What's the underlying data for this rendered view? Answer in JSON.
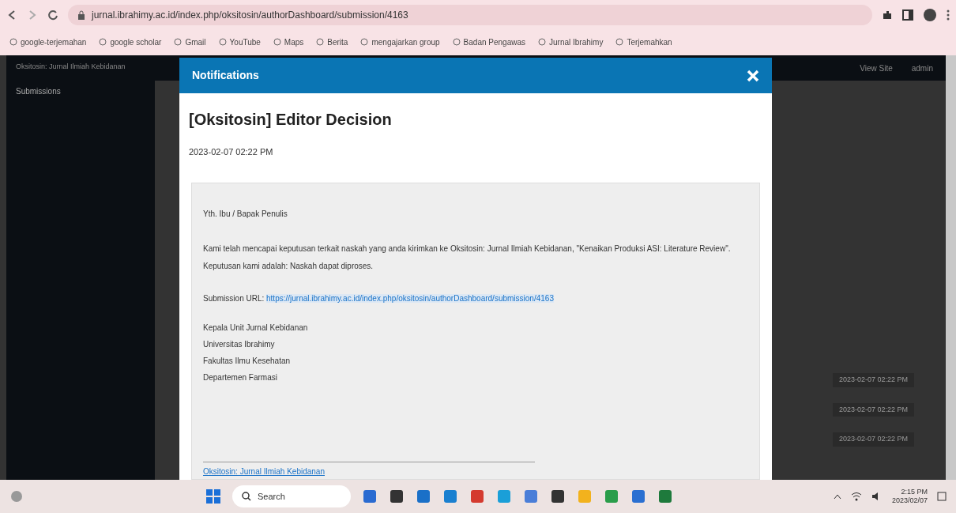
{
  "browser": {
    "url": "jurnal.ibrahimy.ac.id/index.php/oksitosin/authorDashboard/submission/4163",
    "bookmarks": [
      "google-terjemahan",
      "google scholar",
      "Gmail",
      "YouTube",
      "Maps",
      "Berita",
      "mengajarkan group",
      "Badan Pengawas",
      "Jurnal Ibrahimy",
      "Terjemahkan"
    ]
  },
  "site": {
    "title": "Oksitosin: Jurnal Ilmiah Kebidanan",
    "nav_item": "Submissions",
    "header_links": [
      "View Site",
      "admin"
    ],
    "right_rows": [
      "2023-02-07 02:22 PM",
      "2023-02-07 02:22 PM",
      "2023-02-07 02:22 PM"
    ]
  },
  "modal": {
    "header": "Notifications",
    "title": "[Oksitosin] Editor Decision",
    "date": "2023-02-07 02:22 PM",
    "paragraphs": [
      {
        "kind": "text",
        "text": "Yth. Ibu / Bapak Penulis"
      },
      {
        "kind": "text",
        "text": "Kami telah mencapai keputusan terkait naskah yang anda kirimkan ke Oksitosin: Jurnal Ilmiah Kebidanan, \"Kenaikan Produksi ASI: Literature Review\". Keputusan kami adalah: Naskah dapat diproses."
      },
      {
        "kind": "link",
        "label": "Submission URL: ",
        "url": "https://jurnal.ibrahimy.ac.id/index.php/oksitosin/authorDashboard/submission/4163"
      },
      {
        "kind": "lines",
        "lines": [
          "Kepala Unit Jurnal Kebidanan",
          "Universitas Ibrahimy",
          "Fakultas Ilmu Kesehatan",
          "Departemen Farmasi"
        ]
      }
    ],
    "footer_link": "Oksitosin: Jurnal Ilmiah Kebidanan"
  },
  "taskbar": {
    "search": "Search",
    "time": "2:15 PM",
    "date": "2023/02/07"
  }
}
